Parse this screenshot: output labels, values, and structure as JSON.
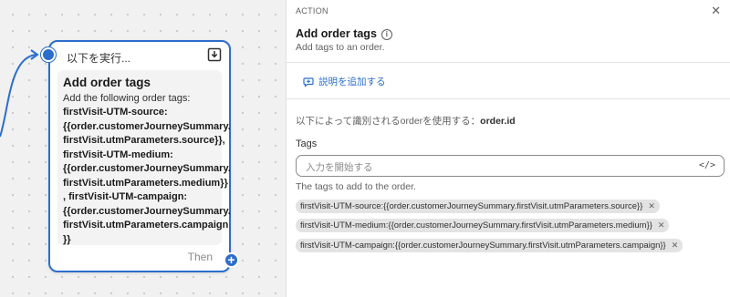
{
  "canvas": {
    "card": {
      "header": "以下を実行...",
      "title": "Add order tags",
      "description": "Add the following order tags:",
      "tag_lines": [
        "firstVisit-UTM-source:",
        "{{order.customerJourneySummary.",
        "firstVisit.utmParameters.source}},",
        "firstVisit-UTM-medium:",
        "{{order.customerJourneySummary.",
        "firstVisit.utmParameters.medium}}",
        ", firstVisit-UTM-campaign:",
        "{{order.customerJourneySummary.",
        "firstVisit.utmParameters.campaign",
        "}}"
      ],
      "then_label": "Then",
      "add_icon": "+"
    }
  },
  "panel": {
    "section_label": "ACTION",
    "close_icon": "✕",
    "title": "Add order tags",
    "info_icon": "i",
    "subtitle": "Add tags to an order.",
    "add_description_label": "説明を追加する",
    "identify_prefix": "以下によって識別されるorderを使用する：",
    "identify_value": "order.id",
    "tags_label": "Tags",
    "tags_placeholder": "入力を開始する",
    "code_icon": "</>",
    "help_text": "The tags to add to the order.",
    "tags": [
      "firstVisit-UTM-source:{{order.customerJourneySummary.firstVisit.utmParameters.source}}",
      "firstVisit-UTM-medium:{{order.customerJourneySummary.firstVisit.utmParameters.medium}}",
      "firstVisit-UTM-campaign:{{order.customerJourneySummary.firstVisit.utmParameters.campaign}}"
    ],
    "tag_remove_icon": "✕"
  },
  "colors": {
    "accent": "#2c6ecb",
    "canvas_bg": "#f1f1f1",
    "chip_bg": "#e3e3e3"
  }
}
